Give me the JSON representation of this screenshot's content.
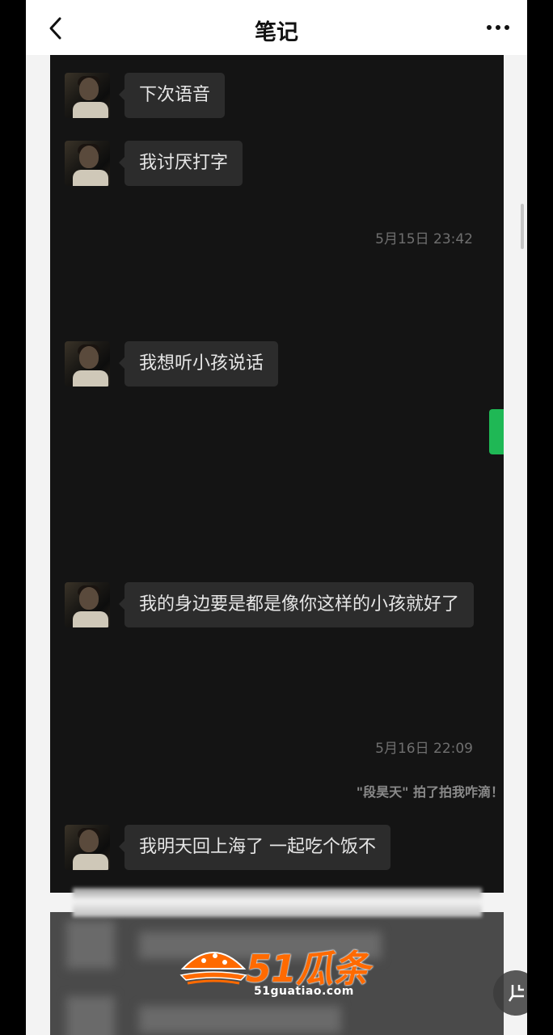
{
  "nav": {
    "title": "笔记",
    "back_icon": "chevron-left-icon",
    "more_icon": "more-dots-icon"
  },
  "chat": {
    "messages": [
      {
        "text": "下次语音"
      },
      {
        "text": "我讨厌打字"
      },
      {
        "timestamp": "5月15日 23:42"
      },
      {
        "text": "我想听小孩说话"
      },
      {
        "text": "我的身边要是都是像你这样的小孩就好了"
      },
      {
        "timestamp": "5月16日 22:09"
      },
      {
        "system": "\"段昊天\" 拍了拍我咋滴！"
      },
      {
        "text": "我明天回上海了 一起吃个饭不"
      }
    ]
  },
  "watermark": {
    "brand": "51瓜条",
    "url": "51guatiao.com"
  },
  "colors": {
    "chat_bg": "#141414",
    "bubble_bg": "#2c2c2c",
    "accent_green": "#1fb855",
    "brand_orange": "#ff6a00"
  }
}
